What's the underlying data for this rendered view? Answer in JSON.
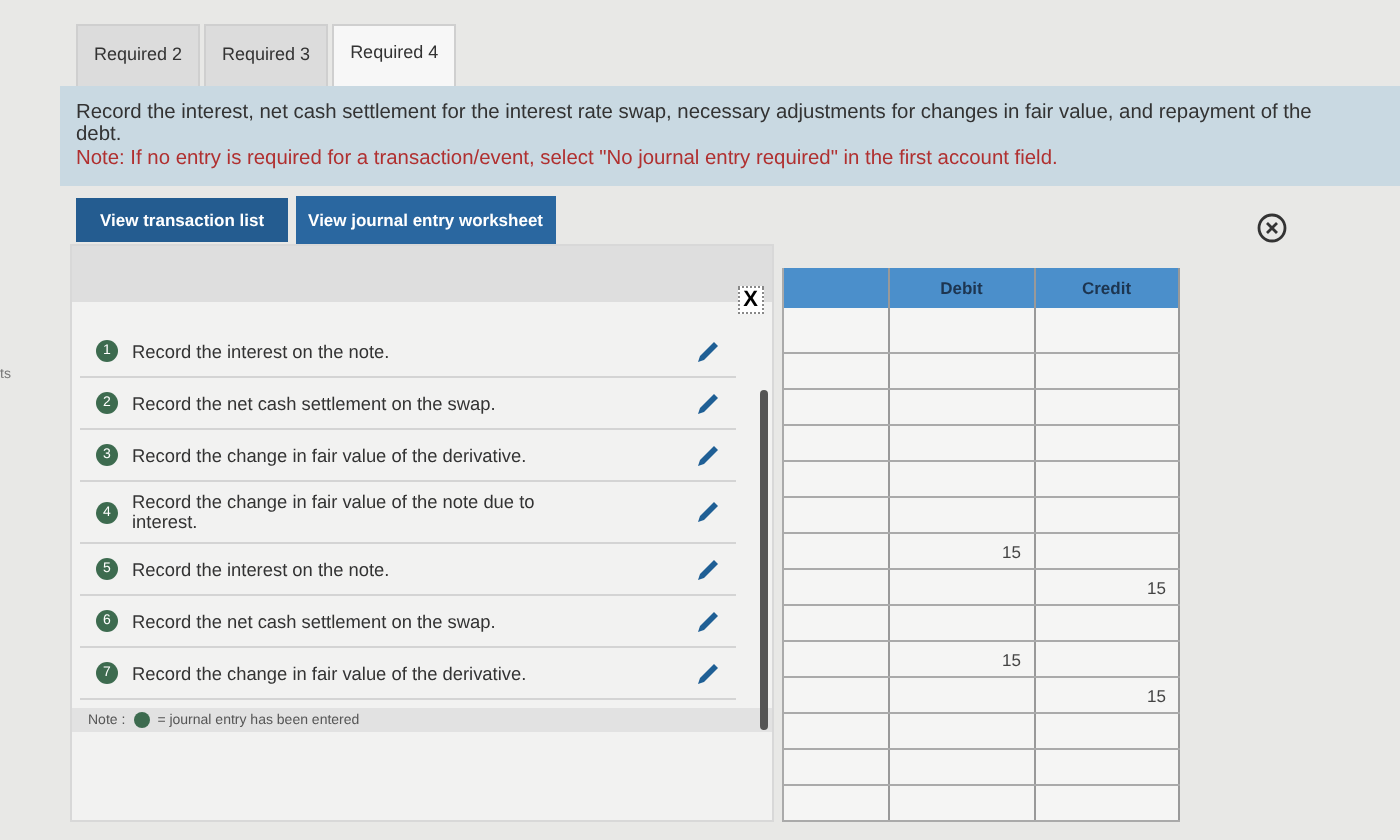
{
  "side_fragment": "ts",
  "tabs": [
    {
      "label": "Required 2",
      "selected": false
    },
    {
      "label": "Required 3",
      "selected": false
    },
    {
      "label": "Required 4",
      "selected": true
    }
  ],
  "instructions": {
    "text": "Record the interest, net cash settlement for the interest rate swap, necessary adjustments for changes in fair value, and repayment of the debt.",
    "note": "Note: If no entry is required for a transaction/event, select \"No journal entry required\" in the first account field."
  },
  "buttons": [
    {
      "label": "View transaction list",
      "selected": true
    },
    {
      "label": "View journal entry worksheet",
      "selected": false
    }
  ],
  "transactions": [
    {
      "number": "1",
      "text": "Record the interest on the note.",
      "entered": true
    },
    {
      "number": "2",
      "text": "Record the net cash settlement on the swap.",
      "entered": true
    },
    {
      "number": "3",
      "text": "Record the change in fair value of the derivative.",
      "entered": true
    },
    {
      "number": "4",
      "text": "Record the change in fair value of the note due to interest.",
      "entered": true
    },
    {
      "number": "5",
      "text": "Record the interest on the note.",
      "entered": true
    },
    {
      "number": "6",
      "text": "Record the net cash settlement on the swap.",
      "entered": true
    },
    {
      "number": "7",
      "text": "Record the change in fair value of the derivative.",
      "entered": true
    }
  ],
  "legend": {
    "prefix": "Note :",
    "text": "= journal entry has been entered"
  },
  "close_label": "X",
  "table": {
    "columns": [
      "Debit",
      "Credit"
    ],
    "rows": [
      {},
      {},
      {},
      {},
      {},
      {},
      {
        "debit": "15"
      },
      {
        "credit": "15"
      },
      {},
      {
        "debit": "15"
      },
      {
        "credit": "15"
      },
      {},
      {},
      {}
    ]
  }
}
